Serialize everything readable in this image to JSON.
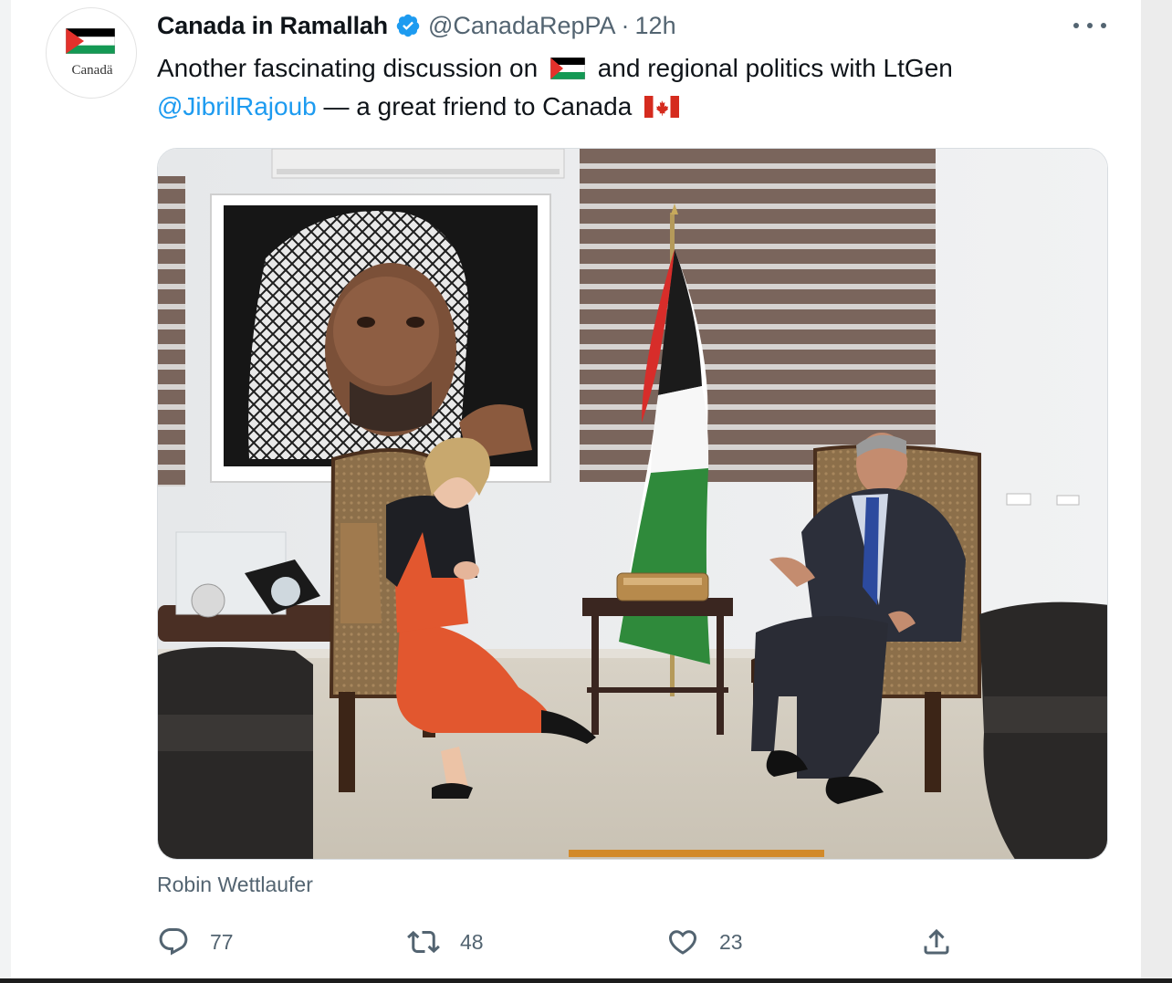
{
  "tweet": {
    "display_name": "Canada in Ramallah",
    "handle": "@CanadaRepPA",
    "separator": "·",
    "time": "12h",
    "verified_icon": "verified-badge-icon",
    "more_icon": "more-options-icon",
    "avatar_text": "Canadä",
    "text": {
      "part1": "Another fascinating discussion on",
      "part2": "and regional politics with LtGen",
      "mention": "@JibrilRajoub",
      "part3": " — a great friend to Canada"
    },
    "inline_emoji": [
      "palestine-flag-icon",
      "canada-flag-icon"
    ],
    "media": {
      "type": "photo",
      "icon": "photo-meeting-image"
    },
    "tagged_people": "Robin Wettlaufer",
    "actions": {
      "reply": {
        "icon": "reply-icon",
        "count": "77"
      },
      "retweet": {
        "icon": "retweet-icon",
        "count": "48"
      },
      "like": {
        "icon": "heart-icon",
        "count": "23"
      },
      "share": {
        "icon": "share-icon"
      }
    }
  },
  "colors": {
    "link": "#1d9bf0",
    "secondary_text": "#536471",
    "verified": "#1d9bf0"
  }
}
